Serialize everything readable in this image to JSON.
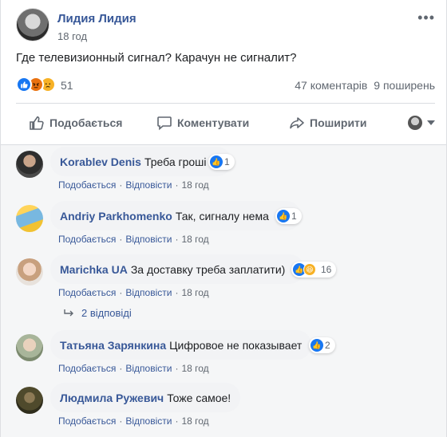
{
  "post": {
    "author": "Лидия Лидия",
    "time": "18 год",
    "text": "Где телевизионный сигнал? Карачун не сигналит?",
    "reaction_count": "51",
    "comments_count": "47 коментарів",
    "shares_count": "9 поширень"
  },
  "actions": {
    "like": "Подобається",
    "comment": "Коментувати",
    "share": "Поширити"
  },
  "comments": [
    {
      "name": "Korablev Denis",
      "text": "Треба гроші",
      "reactions": "1",
      "like": "Подобається",
      "reply": "Відповісти",
      "time": "18 год"
    },
    {
      "name": "Andriy Parkhomenko",
      "text": "Так, сигналу нема",
      "reactions": "1",
      "like": "Подобається",
      "reply": "Відповісти",
      "time": "18 год"
    },
    {
      "name": "Marichka UA",
      "text": "За доставку треба заплатити)",
      "reactions": "16",
      "like": "Подобається",
      "reply": "Відповісти",
      "time": "18 год"
    },
    {
      "name": "Татьяна Зарянкина",
      "text": "Цифровое не показывает",
      "reactions": "2",
      "like": "Подобається",
      "reply": "Відповісти",
      "time": "18 год"
    },
    {
      "name": "Людмила Ружевич",
      "text": "Тоже самое!",
      "like": "Подобається",
      "reply": "Відповісти",
      "time": "18 год"
    }
  ],
  "replies_link": "2 відповіді",
  "colors": {
    "link": "#385898",
    "like": "#1877f2",
    "angry": "#e9710f",
    "sad": "#f7b125"
  }
}
